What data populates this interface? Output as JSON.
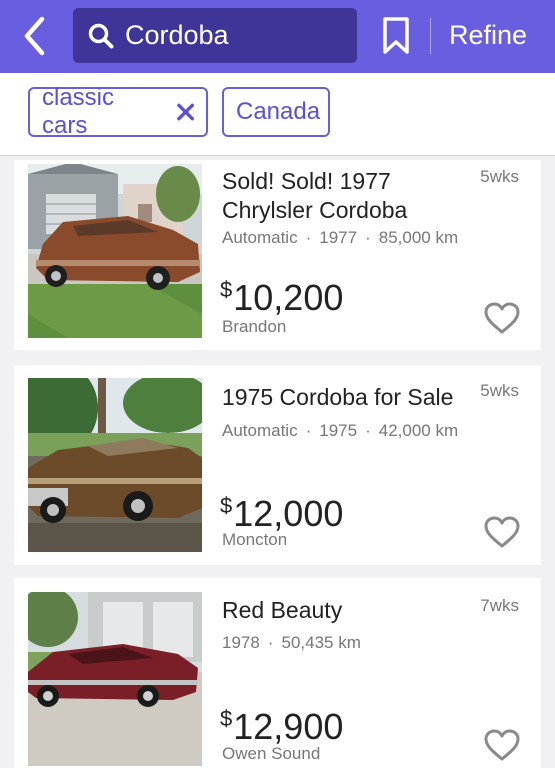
{
  "header": {
    "search_value": "Cordoba",
    "refine_label": "Refine"
  },
  "filters": [
    {
      "label": "classic cars",
      "removable": true
    },
    {
      "label": "Canada",
      "removable": false
    }
  ],
  "listings": [
    {
      "title": "Sold! Sold! 1977 Chrylsler Cordoba",
      "transmission": "Automatic",
      "year": "1977",
      "mileage": "85,000 km",
      "currency": "$",
      "price": "10,200",
      "location": "Brandon",
      "age": "5wks",
      "image": "brown-coupe-in-driveway"
    },
    {
      "title": "1975 Cordoba for Sale",
      "transmission": "Automatic",
      "year": "1975",
      "mileage": "42,000 km",
      "currency": "$",
      "price": "12,000",
      "location": "Moncton",
      "age": "5wks",
      "image": "bronze-coupe-on-lawn"
    },
    {
      "title": "Red Beauty",
      "year": "1978",
      "mileage": "50,435 km",
      "currency": "$",
      "price": "12,900",
      "location": "Owen Sound",
      "age": "7wks",
      "image": "red-coupe-by-garage"
    }
  ],
  "colors": {
    "accent": "#6a5ee0",
    "search_bg": "#3f3599",
    "muted_text": "#777777"
  },
  "icons": [
    "chevron-left-icon",
    "search-icon",
    "bookmark-icon",
    "close-icon",
    "heart-icon"
  ]
}
